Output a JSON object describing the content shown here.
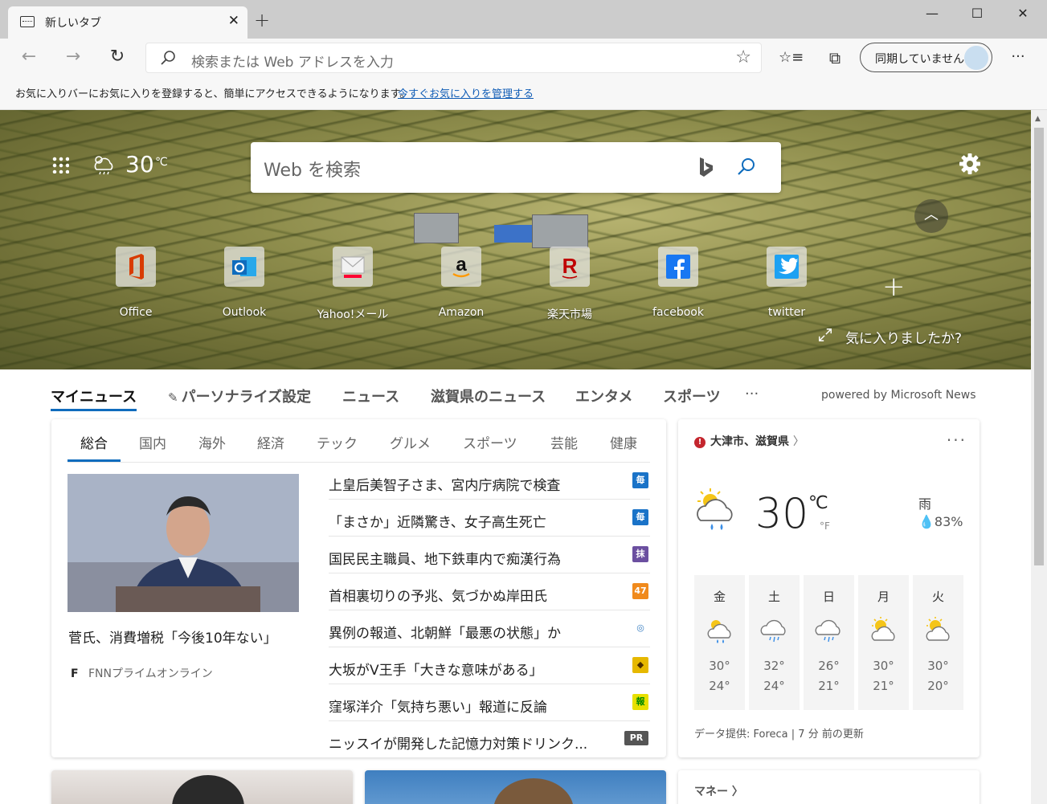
{
  "tab": {
    "title": "新しいタブ",
    "close": "✕"
  },
  "new_tab_symbol": "+",
  "window": {
    "minimize": "—",
    "maximize": "☐",
    "close": "✕"
  },
  "toolbar": {
    "back": "←",
    "forward": "→",
    "refresh": "↻",
    "address_placeholder": "検索または Web アドレスを入力",
    "favorite_star": "☆",
    "favorites": "☆≡",
    "collections": "⧉",
    "sync_label": "同期していません",
    "more": "···"
  },
  "favorites_hint": {
    "text": "お気に入りバーにお気に入りを登録すると、簡単にアクセスできるようになります。",
    "link": "今すぐお気に入りを管理する"
  },
  "hero": {
    "temperature": "30",
    "unit": "℃",
    "search_placeholder": "Web を検索",
    "collapse": "︿",
    "add_tile": "+",
    "feedback": "気に入りましたか?",
    "tiles": [
      {
        "label": "Office",
        "icon": "office-icon",
        "color": "#d83b01"
      },
      {
        "label": "Outlook",
        "icon": "outlook-icon",
        "color": "#0f6cbd"
      },
      {
        "label": "Yahoo!メール",
        "icon": "yahoo-mail-icon",
        "color": "#ff0033"
      },
      {
        "label": "Amazon",
        "icon": "amazon-icon",
        "color": "#111111"
      },
      {
        "label": "楽天市場",
        "icon": "rakuten-icon",
        "color": "#bf0000"
      },
      {
        "label": "facebook",
        "icon": "facebook-icon",
        "color": "#1877f2"
      },
      {
        "label": "twitter",
        "icon": "twitter-icon",
        "color": "#1da1f2"
      }
    ]
  },
  "news_nav": {
    "items": [
      "マイニュース",
      "パーソナライズ設定",
      "ニュース",
      "滋賀県のニュース",
      "エンタメ",
      "スポーツ"
    ],
    "more": "···",
    "powered": "powered by Microsoft News"
  },
  "news": {
    "subtabs": [
      "総合",
      "国内",
      "海外",
      "経済",
      "テック",
      "グルメ",
      "スポーツ",
      "芸能",
      "健康"
    ],
    "feature": {
      "title": "菅氏、消費増税「今後10年ない」",
      "source": "FNNプライムオンライン",
      "source_logo": "F"
    },
    "headlines": [
      {
        "text": "上皇后美智子さま、宮内庁病院で検査",
        "badge": "毎",
        "badge_bg": "#1a73c8",
        "badge_fg": "#ffffff"
      },
      {
        "text": "「まさか」近隣驚き、女子高生死亡",
        "badge": "毎",
        "badge_bg": "#1a73c8",
        "badge_fg": "#ffffff"
      },
      {
        "text": "国民民主職員、地下鉄車内で痴漢行為",
        "badge": "抹",
        "badge_bg": "#6b4fa0",
        "badge_fg": "#ffffff"
      },
      {
        "text": "首相裏切りの予兆、気づかぬ岸田氏",
        "badge": "47",
        "badge_bg": "#f08a1c",
        "badge_fg": "#ffffff"
      },
      {
        "text": "異例の報道、北朝鮮「最悪の状態」か",
        "badge": "◎",
        "badge_bg": "#ffffff",
        "badge_fg": "#3a7fc2"
      },
      {
        "text": "大坂がV王手「大きな意味がある」",
        "badge": "◆",
        "badge_bg": "#e6b800",
        "badge_fg": "#4a2d00"
      },
      {
        "text": "窪塚洋介「気持ち悪い」報道に反論",
        "badge": "報",
        "badge_bg": "#e8e000",
        "badge_fg": "#008800"
      },
      {
        "text": "ニッスイが開発した記憶力対策ドリンク...",
        "badge": "PR",
        "badge_bg": "#555555",
        "badge_fg": "#ffffff"
      }
    ]
  },
  "weather": {
    "alert": "!",
    "location": "大津市、滋賀県",
    "chevron": "〉",
    "more": "···",
    "temperature": "30",
    "unit_c": "℃",
    "unit_f": "°F",
    "condition": "雨",
    "rain": "83%",
    "forecast": [
      {
        "day": "金",
        "hi": "30°",
        "lo": "24°",
        "icon": "partly-sunny-rain-icon"
      },
      {
        "day": "土",
        "hi": "32°",
        "lo": "24°",
        "icon": "rain-cloud-icon"
      },
      {
        "day": "日",
        "hi": "26°",
        "lo": "21°",
        "icon": "rain-cloud-icon"
      },
      {
        "day": "月",
        "hi": "30°",
        "lo": "21°",
        "icon": "partly-cloudy-icon"
      },
      {
        "day": "火",
        "hi": "30°",
        "lo": "20°",
        "icon": "partly-cloudy-icon"
      }
    ],
    "source": "データ提供: Foreca | 7 分 前の更新"
  },
  "money": {
    "label": "マネー 〉"
  }
}
